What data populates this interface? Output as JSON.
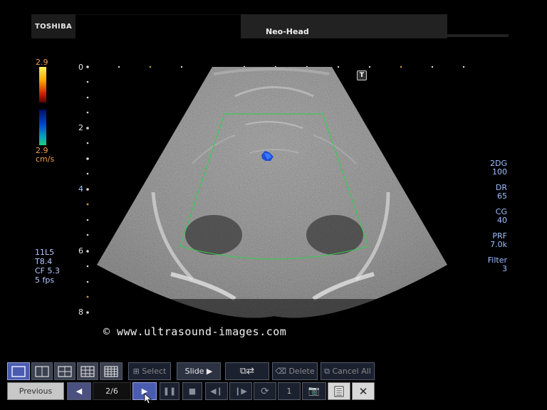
{
  "header": {
    "brand": "TOSHIBA",
    "title": "Neo-Head"
  },
  "colorbar": {
    "top_value": "2.9",
    "bottom_value": "2.9",
    "unit": "cm/s"
  },
  "depth_scale": {
    "labels": [
      "0",
      "2",
      "4",
      "6",
      "8"
    ]
  },
  "params_left": {
    "probe": "11L5",
    "tb": "T8.4",
    "cf": "CF 5.3",
    "fps": "5 fps"
  },
  "params_right": [
    {
      "label": "2DG",
      "value": "100"
    },
    {
      "label": "DR",
      "value": "65"
    },
    {
      "label": "CG",
      "value": "40"
    },
    {
      "label": "PRF",
      "value": "7.0k"
    },
    {
      "label": "Filter",
      "value": "3"
    }
  ],
  "orientation_marker": "T",
  "watermark": "© www.ultrasound-images.com",
  "toolbar": {
    "select_label": "Select",
    "slide_label": "Slide ▶",
    "delete_label": "Delete",
    "cancel_all_label": "Cancel All",
    "previous_label": "Previous",
    "page_counter": "2/6",
    "frame_number": "1"
  },
  "colors": {
    "roi_box": "#2fd04a",
    "doppler": "#1f4fd8",
    "accent": "#4a5cb0"
  }
}
